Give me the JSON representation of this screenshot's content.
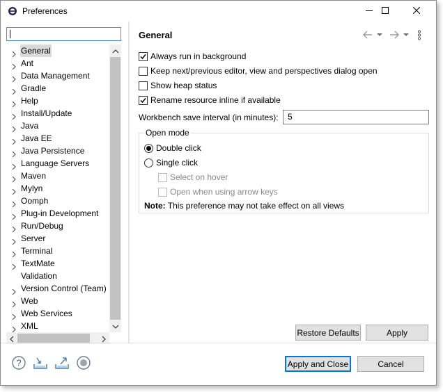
{
  "window": {
    "title": "Preferences"
  },
  "titlebar": {
    "app_icon": "eclipse-icon",
    "controls": [
      "minimize-icon",
      "maximize-icon",
      "close-icon"
    ]
  },
  "filter": {
    "value": ""
  },
  "tree": {
    "items": [
      {
        "label": "General",
        "selected": true,
        "expandable": true
      },
      {
        "label": "Ant",
        "expandable": true
      },
      {
        "label": "Data Management",
        "expandable": true
      },
      {
        "label": "Gradle",
        "expandable": true
      },
      {
        "label": "Help",
        "expandable": true
      },
      {
        "label": "Install/Update",
        "expandable": true
      },
      {
        "label": "Java",
        "expandable": true
      },
      {
        "label": "Java EE",
        "expandable": true
      },
      {
        "label": "Java Persistence",
        "expandable": true
      },
      {
        "label": "Language Servers",
        "expandable": true
      },
      {
        "label": "Maven",
        "expandable": true
      },
      {
        "label": "Mylyn",
        "expandable": true
      },
      {
        "label": "Oomph",
        "expandable": true
      },
      {
        "label": "Plug-in Development",
        "expandable": true
      },
      {
        "label": "Run/Debug",
        "expandable": true
      },
      {
        "label": "Server",
        "expandable": true
      },
      {
        "label": "Terminal",
        "expandable": true
      },
      {
        "label": "TextMate",
        "expandable": true
      },
      {
        "label": "Validation",
        "expandable": false
      },
      {
        "label": "Version Control (Team)",
        "expandable": true
      },
      {
        "label": "Web",
        "expandable": true
      },
      {
        "label": "Web Services",
        "expandable": true
      },
      {
        "label": "XML",
        "expandable": true
      }
    ]
  },
  "page": {
    "title": "General",
    "nav_icons": [
      "back-arrow-icon",
      "dropdown-icon",
      "forward-arrow-icon",
      "dropdown-icon",
      "view-menu-icon"
    ],
    "options": [
      {
        "label": "Always run in background",
        "checked": true
      },
      {
        "label": "Keep next/previous editor, view and perspectives dialog open",
        "checked": false
      },
      {
        "label": "Show heap status",
        "checked": false
      },
      {
        "label": "Rename resource inline if available",
        "checked": true
      }
    ],
    "interval": {
      "label": "Workbench save interval (in minutes):",
      "value": "5"
    },
    "open_mode": {
      "title": "Open mode",
      "double_click": "Double click",
      "single_click": "Single click",
      "select_on_hover": "Select on hover",
      "open_arrow_keys": "Open when using arrow keys",
      "selected": "double_click",
      "note_label": "Note:",
      "note_text": "This preference may not take effect on all views"
    },
    "restore_defaults": "Restore Defaults",
    "apply": "Apply"
  },
  "footer": {
    "icons": [
      "help-icon",
      "import-icon",
      "export-icon",
      "record-icon"
    ],
    "apply_close": "Apply and Close",
    "cancel": "Cancel"
  },
  "colors": {
    "accent": "#0078d7",
    "selection": "#d9d9d9",
    "button_bg": "#e1e1e1"
  }
}
